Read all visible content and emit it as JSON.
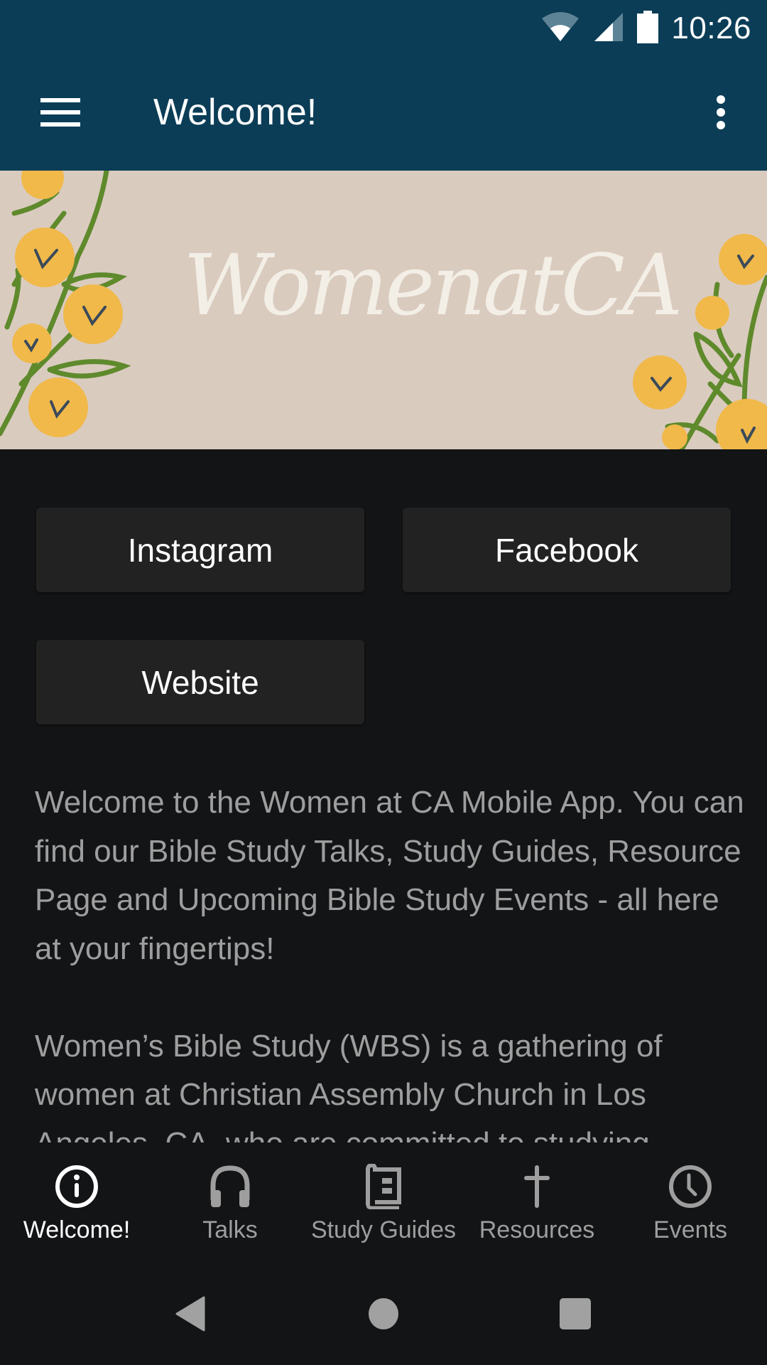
{
  "status_bar": {
    "time": "10:26",
    "icons": [
      "wifi-icon",
      "cell-signal-icon",
      "battery-icon"
    ]
  },
  "app_bar": {
    "title": "Welcome!",
    "menu_icon": "hamburger-menu-icon",
    "overflow_icon": "more-vert-icon"
  },
  "banner": {
    "title": "WomenatCA"
  },
  "links": {
    "instagram": "Instagram",
    "facebook": "Facebook",
    "website": "Website"
  },
  "content": {
    "paragraphs": [
      "Welcome to the Women at CA Mobile App. You can find our Bible Study Talks, Study Guides, Resource Page and Upcoming Bible Study Events - all here at your fingertips!",
      "Women’s Bible Study (WBS) is a gathering of women at Christian Assembly Church in Los Angeles, CA, who are committed to studying"
    ]
  },
  "bottom_nav": {
    "items": [
      {
        "label": "Welcome!",
        "icon": "info-icon",
        "active": true
      },
      {
        "label": "Talks",
        "icon": "headphones-icon",
        "active": false
      },
      {
        "label": "Study Guides",
        "icon": "book-icon",
        "active": false
      },
      {
        "label": "Resources",
        "icon": "cross-icon",
        "active": false
      },
      {
        "label": "Events",
        "icon": "clock-icon",
        "active": false
      }
    ]
  },
  "colors": {
    "primary": "#0b3d57",
    "background": "#131416",
    "button": "#222222",
    "text_muted": "#9e9e9e",
    "banner_bg": "#dacbbf",
    "flower": "#f0b94a",
    "leaf": "#5f8a2c"
  }
}
